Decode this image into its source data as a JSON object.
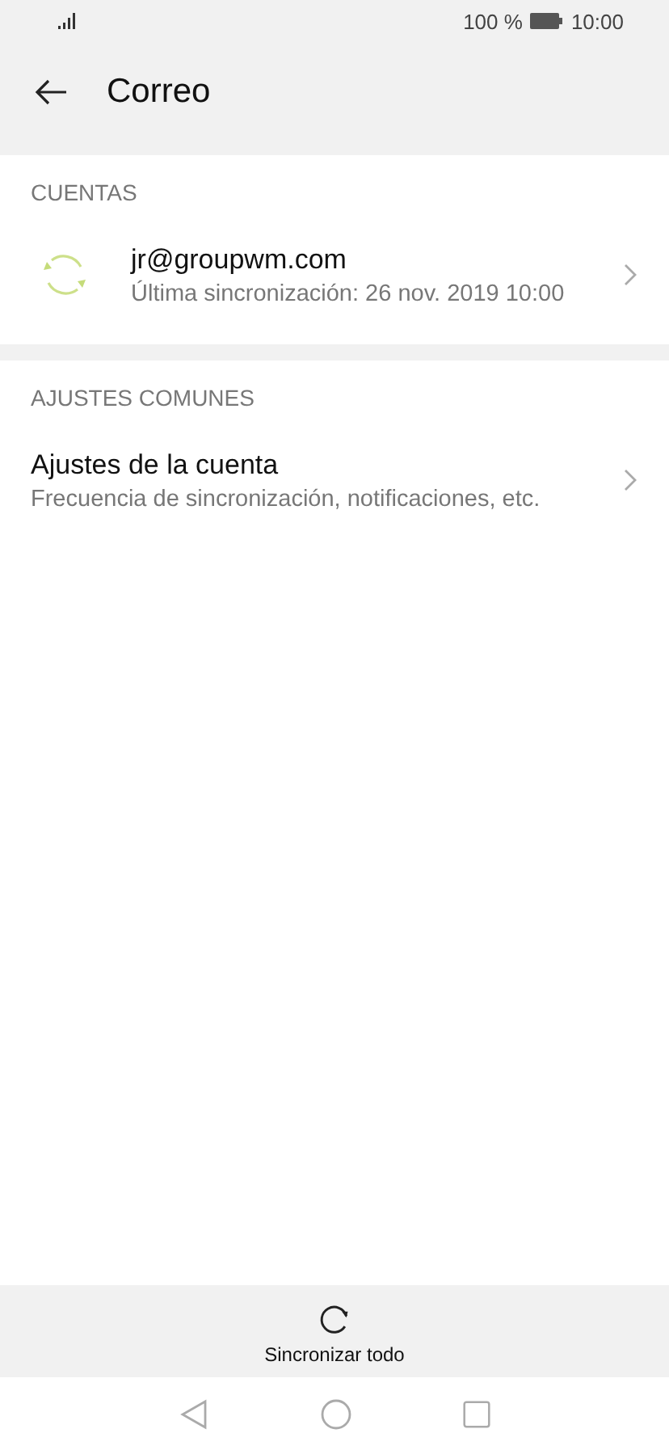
{
  "status_bar": {
    "battery": "100 %",
    "time": "10:00"
  },
  "header": {
    "title": "Correo"
  },
  "sections": [
    {
      "title": "CUENTAS",
      "items": [
        {
          "kind": "account",
          "title": "jr@groupwm.com",
          "subtitle": "Última sincronización: 26 nov. 2019 10:00"
        }
      ]
    },
    {
      "title": "AJUSTES COMUNES",
      "items": [
        {
          "kind": "setting",
          "title": "Ajustes de la cuenta",
          "subtitle": "Frecuencia de sincronización, notificaciones, etc."
        }
      ]
    }
  ],
  "bottom_action": {
    "label": "Sincronizar todo"
  }
}
